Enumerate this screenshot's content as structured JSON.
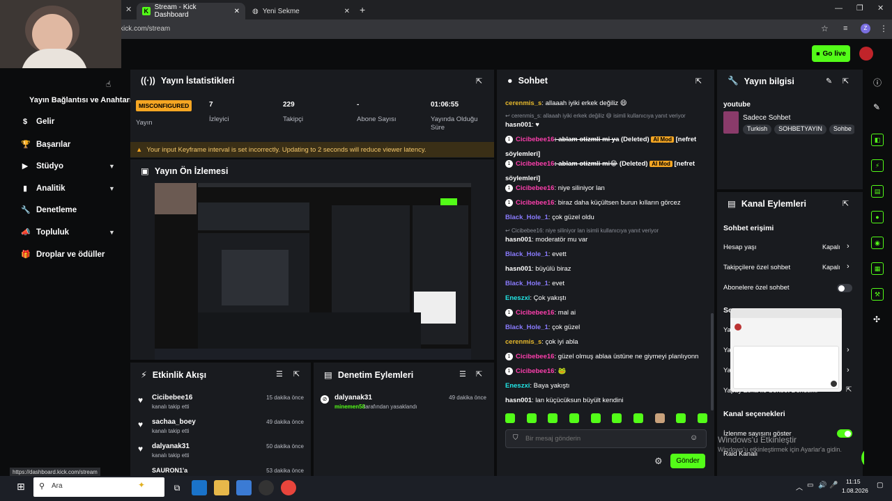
{
  "browser": {
    "tabs": [
      {
        "label": "Stream - Kick Dashboard"
      },
      {
        "label": "Yeni Sekme"
      }
    ],
    "url": "kick.com/stream",
    "profile_letter": "Z",
    "status_url": "https://dashboard.kick.com/stream"
  },
  "header": {
    "go_live": "Go live"
  },
  "sidebar": {
    "cut_label": "Yayın Bağlantısı ve Anahtarı",
    "items": [
      {
        "label": "Gelir"
      },
      {
        "label": "Başarılar"
      },
      {
        "label": "Stüdyo"
      },
      {
        "label": "Analitik"
      },
      {
        "label": "Denetleme"
      },
      {
        "label": "Topluluk"
      },
      {
        "label": "Droplar ve ödüller"
      }
    ]
  },
  "stats": {
    "title": "Yayın İstatistikleri",
    "items": [
      {
        "value": "MISCONFIGURED",
        "label": "Yayın"
      },
      {
        "value": "7",
        "label": "İzleyici"
      },
      {
        "value": "229",
        "label": "Takipçi"
      },
      {
        "value": "-",
        "label": "Abone Sayısı"
      },
      {
        "value": "01:06:55",
        "label": "Yayında Olduğu Süre"
      }
    ],
    "warning": "Your input Keyframe interval is set incorrectly. Updating to 2 seconds will reduce viewer latency."
  },
  "preview": {
    "title": "Yayın Ön İzlemesi"
  },
  "activity": {
    "title": "Etkinlik Akışı",
    "items": [
      {
        "user": "Cicibebee16",
        "action": "kanalı takip etti",
        "time": "15 dakika önce"
      },
      {
        "user": "sachaa_boey",
        "action": "kanalı takip etti",
        "time": "49 dakika önce"
      },
      {
        "user": "dalyanak31",
        "action": "kanalı takip etti",
        "time": "50 dakika önce"
      },
      {
        "user": "SAURON1'a",
        "action": "",
        "time": "53 dakika önce"
      }
    ]
  },
  "moderation": {
    "title": "Denetim Eylemleri",
    "items": [
      {
        "user": "dalyanak31",
        "by": "minemen58",
        "action": "tarafından yasaklandı",
        "time": "49 dakika önce"
      }
    ]
  },
  "chat": {
    "title": "Sohbet",
    "messages": [
      {
        "user": "cerenmis_s",
        "cls": "u3",
        "text": ": allaaah iyiki erkek değiliz 😄"
      },
      {
        "reply": "cerenmis_s: allaaah iyiki erkek değiliz 😄 isimli kullanıcıya yanıt veriyor"
      },
      {
        "user": "hasn001",
        "cls": "u5",
        "text": ": ♥"
      },
      {
        "user": "Cicibebee16",
        "cls": "u1",
        "badge": "1",
        "text": ": ablam otizmli mi ya",
        "deleted": "(Deleted)",
        "aimod": "AI Mod",
        "tag": "[nefret"
      },
      {
        "cont": "söylemleri]"
      },
      {
        "user": "Cicibebee16",
        "cls": "u1",
        "badge": "1",
        "text": ": ablam otizmli mi😂",
        "deleted": "(Deleted)",
        "aimod": "AI Mod",
        "tag": "[nefret"
      },
      {
        "cont": "söylemleri]"
      },
      {
        "user": "Cicibebee16",
        "cls": "u1",
        "badge": "1",
        "text": ": niye siliniyor lan"
      },
      {
        "user": "Cicibebee16",
        "cls": "u1",
        "badge": "1",
        "text": ": biraz daha küçültsen burun kılların görcez"
      },
      {
        "user": "Black_Hole_1",
        "cls": "u2",
        "text": ": çok güzel oldu"
      },
      {
        "reply": "Cicibebee16: niye siliniyor lan isimli kullanıcıya yanıt veriyor"
      },
      {
        "user": "hasn001",
        "cls": "u5",
        "text": ": moderatör mu var"
      },
      {
        "user": "Black_Hole_1",
        "cls": "u2",
        "text": ": evett"
      },
      {
        "user": "hasn001",
        "cls": "u5",
        "text": ": büyülü biraz"
      },
      {
        "user": "Black_Hole_1",
        "cls": "u2",
        "text": ": evet"
      },
      {
        "user": "Eneszxi",
        "cls": "u4",
        "text": ": Çok yakıştı"
      },
      {
        "user": "Cicibebee16",
        "cls": "u1",
        "badge": "1",
        "text": ": mal ai"
      },
      {
        "user": "Black_Hole_1",
        "cls": "u2",
        "text": ": çok güzel"
      },
      {
        "user": "cerenmis_s",
        "cls": "u3",
        "text": ": çok iyi abla"
      },
      {
        "user": "Cicibebee16",
        "cls": "u1",
        "badge": "1",
        "text": ": güzel olmuş ablaa üstüne ne giymeyi planlıyonn"
      },
      {
        "user": "Cicibebee16",
        "cls": "u1",
        "badge": "1",
        "text": ": 🐸"
      },
      {
        "user": "Eneszxi",
        "cls": "u4",
        "text": ": Baya yakıştı"
      },
      {
        "user": "hasn001",
        "cls": "u5",
        "text": ": lan küçücüksun büyült kendini"
      }
    ],
    "placeholder": "Bir mesaj gönderin",
    "send": "Gönder"
  },
  "info": {
    "title": "Yayın bilgisi",
    "category": "youtube",
    "stream_title": "Sadece Sohbet",
    "tags": [
      "Turkish",
      "SOHBETYAYIN",
      "Sohbe"
    ]
  },
  "channel": {
    "title": "Kanal Eylemleri",
    "section1": "Sohbet erişimi",
    "rows": [
      {
        "label": "Hesap yaşı",
        "value": "Kapalı"
      },
      {
        "label": "Takipçilere özel sohbet",
        "value": "Kapalı"
      },
      {
        "label": "Abonelere özel sohbet",
        "value": ""
      }
    ],
    "partial": [
      "So",
      "Ya",
      "Ya",
      "Ya"
    ],
    "ai_row": "Yapay Zeka ile Sohbet Denetimi",
    "section2": "Kanal seçenekleri",
    "viewer_count": "İzlenme sayısını göster",
    "raid": "Raid Kanalı"
  },
  "watermark": {
    "line1": "Windows'u Etkinleştir",
    "line2": "Windows'u etkinleştirmek için Ayarlar'a gidin."
  },
  "taskbar": {
    "search": "Ara",
    "time": "11:15",
    "date": "1.08.2026"
  },
  "colors": {
    "accent": "#53fc18",
    "panel": "#191b1f",
    "warning": "#f5a623"
  }
}
